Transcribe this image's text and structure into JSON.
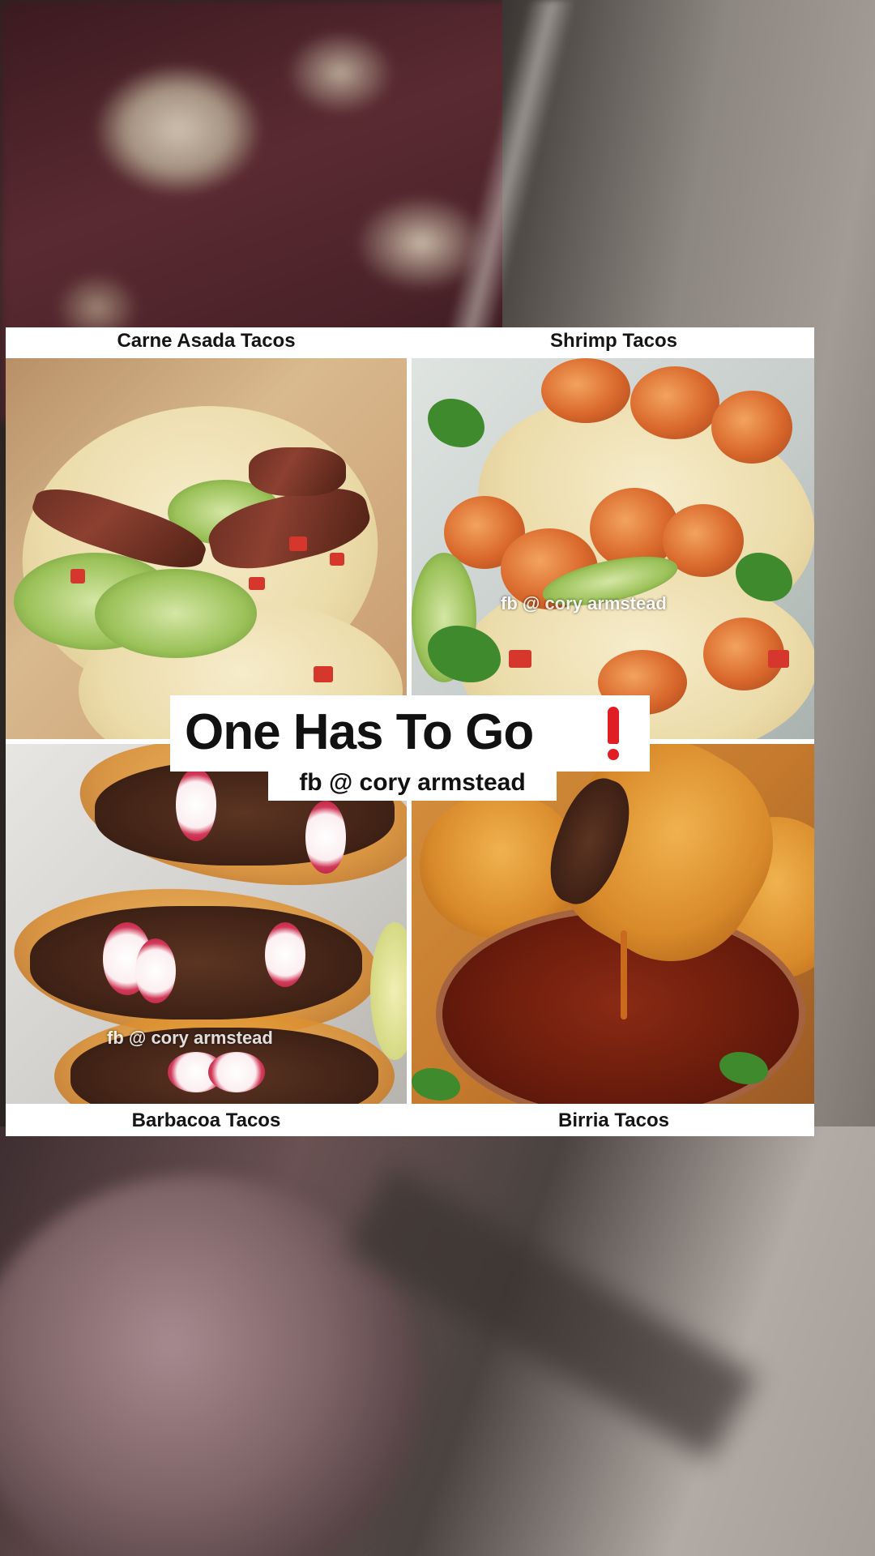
{
  "collage": {
    "captions": {
      "top_left": "Carne Asada Tacos",
      "top_right": "Shrimp Tacos",
      "bottom_left": "Barbacoa Tacos",
      "bottom_right": "Birria Tacos"
    },
    "title": "One Has To Go",
    "title_icon": "red-exclamation-icon",
    "credit": "fb @ cory armstead",
    "watermarks": {
      "shrimp": "fb @ cory armstead",
      "barbacoa": "fb @ cory armstead"
    },
    "accent_color": "#e01c24"
  }
}
